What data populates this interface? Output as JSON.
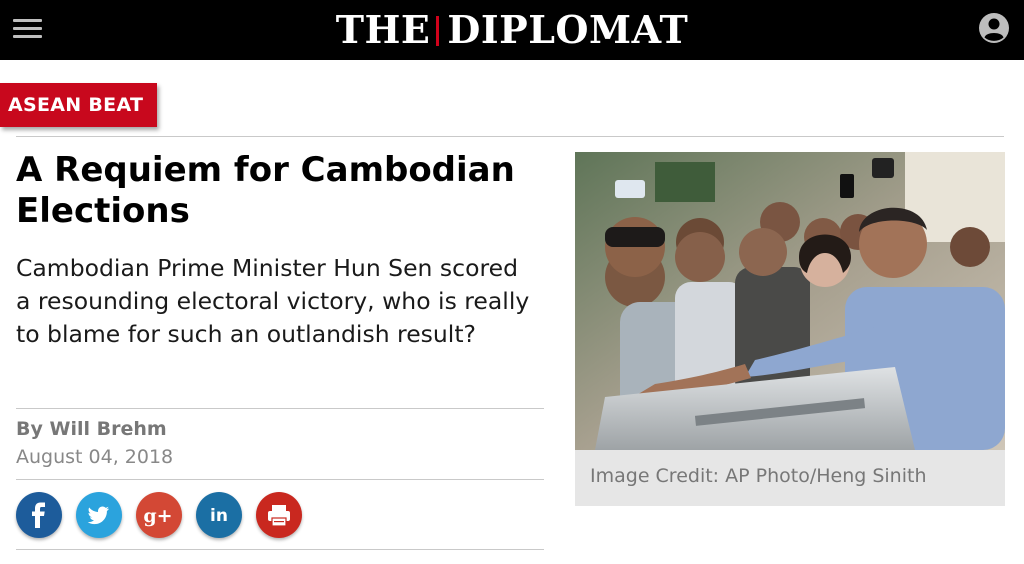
{
  "header": {
    "logo_left": "THE",
    "logo_right": "DIPLOMAT",
    "menu_icon": "hamburger-menu-icon",
    "user_icon": "user-account-icon"
  },
  "article": {
    "section": "ASEAN BEAT",
    "headline": "A Requiem for Cambodian Elections",
    "dek": "Cambodian Prime Minister Hun Sen scored a resounding electoral victory, who is really to blame for such an outlandish result?",
    "byline": "By Will Brehm",
    "date": "August 04, 2018"
  },
  "share": [
    {
      "network": "facebook",
      "icon": "facebook-icon",
      "color": "#1d5c9b"
    },
    {
      "network": "twitter",
      "icon": "twitter-icon",
      "color": "#2ba3dd"
    },
    {
      "network": "google-plus",
      "icon": "google-plus-icon",
      "color": "#d34835"
    },
    {
      "network": "linkedin",
      "icon": "linkedin-icon",
      "color": "#1b6fa4"
    },
    {
      "network": "print",
      "icon": "print-icon",
      "color": "#c9281f"
    }
  ],
  "image": {
    "caption": "Image Credit: AP Photo/Heng Sinith"
  },
  "colors": {
    "brand_red": "#c8081d",
    "header_bg": "#000000"
  }
}
